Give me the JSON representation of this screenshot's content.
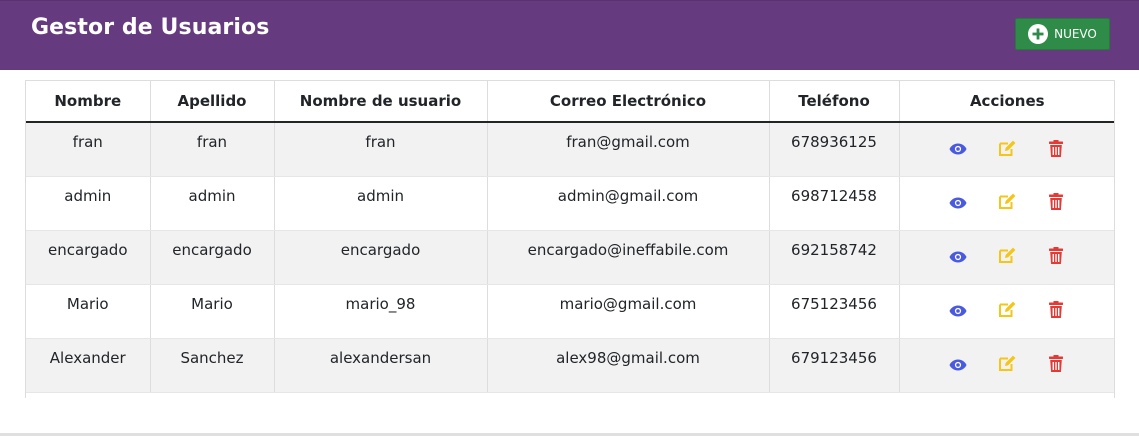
{
  "header": {
    "title": "Gestor de Usuarios",
    "new_button_label": "NUEVO",
    "new_button_icon": "plus-circle-icon"
  },
  "colors": {
    "header_bg": "#663a7e",
    "new_button_bg": "#2e8b48",
    "view_icon": "#4a5ae0",
    "edit_icon": "#f5c518",
    "delete_icon": "#e53935"
  },
  "table": {
    "columns": [
      "Nombre",
      "Apellido",
      "Nombre de usuario",
      "Correo Electrónico",
      "Teléfono",
      "Acciones"
    ],
    "row_action_icons": [
      "eye-icon",
      "edit-icon",
      "trash-icon"
    ],
    "rows": [
      {
        "nombre": "fran",
        "apellido": "fran",
        "usuario": "fran",
        "correo": "fran@gmail.com",
        "telefono": "678936125"
      },
      {
        "nombre": "admin",
        "apellido": "admin",
        "usuario": "admin",
        "correo": "admin@gmail.com",
        "telefono": "698712458"
      },
      {
        "nombre": "encargado",
        "apellido": "encargado",
        "usuario": "encargado",
        "correo": "encargado@ineffabile.com",
        "telefono": "692158742"
      },
      {
        "nombre": "Mario",
        "apellido": "Mario",
        "usuario": "mario_98",
        "correo": "mario@gmail.com",
        "telefono": "675123456"
      },
      {
        "nombre": "Alexander",
        "apellido": "Sanchez",
        "usuario": "alexandersan",
        "correo": "alex98@gmail.com",
        "telefono": "679123456"
      }
    ]
  }
}
